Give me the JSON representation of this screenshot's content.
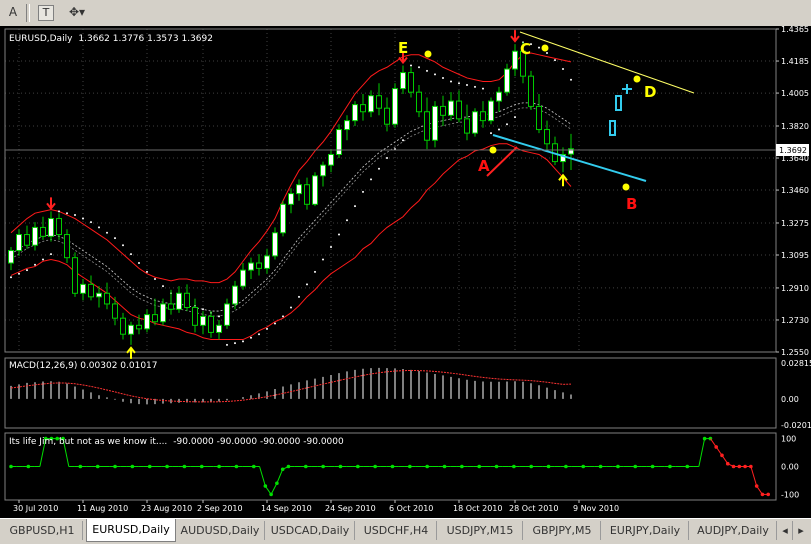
{
  "toolbar": {
    "text_tool": "A",
    "label_tool": "T",
    "arrows_tool": "✥▾"
  },
  "colors": {
    "background": "#000000",
    "grid": "#404040",
    "bull_candle": "#ffffff",
    "bear_candle": "#000000",
    "candle_outline": "#00cc00",
    "bands": "#ff1a1a",
    "sar_dots": "#ffffff",
    "macd_hist": "#ffffff",
    "macd_signal": "#ff3333",
    "life_green": "#00e000",
    "life_red": "#ff2020",
    "resistance_line": "#ffff66",
    "support_line": "#33ccee",
    "annotation_yellow": "#ffff00",
    "annotation_red": "#ff1010"
  },
  "chart_data": [
    {
      "type": "candlestick",
      "title": "EURUSD,Daily",
      "ohlc_text": "1.3662 1.3776 1.3573 1.3692",
      "current_price": "1.3692",
      "ylim": [
        1.255,
        1.4365
      ],
      "y_ticks": [
        "1.4365",
        "1.4185",
        "1.4005",
        "1.3820",
        "1.3640",
        "1.3460",
        "1.3275",
        "1.3095",
        "1.2910",
        "1.2730",
        "1.2550"
      ],
      "x_labels": [
        "30 Jul 2010",
        "11 Aug 2010",
        "23 Aug 2010",
        "2 Sep 2010",
        "14 Sep 2010",
        "24 Sep 2010",
        "6 Oct 2010",
        "18 Oct 2010",
        "28 Oct 2010",
        "9 Nov 2010"
      ],
      "x_label_bars": [
        1,
        9,
        17,
        24,
        32,
        40,
        48,
        56,
        63,
        71
      ],
      "bars": [
        [
          1.305,
          1.314,
          1.301,
          1.312
        ],
        [
          1.312,
          1.324,
          1.309,
          1.321
        ],
        [
          1.321,
          1.326,
          1.313,
          1.315
        ],
        [
          1.315,
          1.328,
          1.312,
          1.325
        ],
        [
          1.325,
          1.331,
          1.318,
          1.32
        ],
        [
          1.32,
          1.334,
          1.317,
          1.33
        ],
        [
          1.33,
          1.333,
          1.318,
          1.321
        ],
        [
          1.321,
          1.324,
          1.305,
          1.308
        ],
        [
          1.308,
          1.311,
          1.286,
          1.288
        ],
        [
          1.288,
          1.296,
          1.284,
          1.293
        ],
        [
          1.293,
          1.298,
          1.284,
          1.286
        ],
        [
          1.286,
          1.292,
          1.28,
          1.288
        ],
        [
          1.288,
          1.294,
          1.279,
          1.282
        ],
        [
          1.282,
          1.286,
          1.27,
          1.274
        ],
        [
          1.274,
          1.277,
          1.262,
          1.265
        ],
        [
          1.265,
          1.272,
          1.259,
          1.27
        ],
        [
          1.27,
          1.276,
          1.265,
          1.268
        ],
        [
          1.268,
          1.279,
          1.266,
          1.276
        ],
        [
          1.276,
          1.285,
          1.27,
          1.272
        ],
        [
          1.272,
          1.285,
          1.27,
          1.282
        ],
        [
          1.282,
          1.29,
          1.276,
          1.279
        ],
        [
          1.279,
          1.292,
          1.277,
          1.288
        ],
        [
          1.288,
          1.293,
          1.278,
          1.28
        ],
        [
          1.28,
          1.285,
          1.266,
          1.27
        ],
        [
          1.27,
          1.278,
          1.265,
          1.275
        ],
        [
          1.275,
          1.278,
          1.263,
          1.266
        ],
        [
          1.266,
          1.273,
          1.262,
          1.27
        ],
        [
          1.27,
          1.285,
          1.268,
          1.282
        ],
        [
          1.282,
          1.295,
          1.279,
          1.292
        ],
        [
          1.292,
          1.305,
          1.29,
          1.301
        ],
        [
          1.301,
          1.308,
          1.296,
          1.305
        ],
        [
          1.305,
          1.31,
          1.298,
          1.302
        ],
        [
          1.302,
          1.313,
          1.299,
          1.309
        ],
        [
          1.309,
          1.325,
          1.307,
          1.322
        ],
        [
          1.322,
          1.34,
          1.32,
          1.338
        ],
        [
          1.338,
          1.347,
          1.333,
          1.344
        ],
        [
          1.344,
          1.352,
          1.34,
          1.349
        ],
        [
          1.349,
          1.353,
          1.335,
          1.338
        ],
        [
          1.338,
          1.356,
          1.337,
          1.354
        ],
        [
          1.354,
          1.362,
          1.348,
          1.36
        ],
        [
          1.36,
          1.369,
          1.356,
          1.366
        ],
        [
          1.366,
          1.383,
          1.364,
          1.38
        ],
        [
          1.38,
          1.388,
          1.374,
          1.385
        ],
        [
          1.385,
          1.396,
          1.382,
          1.394
        ],
        [
          1.394,
          1.4,
          1.385,
          1.39
        ],
        [
          1.39,
          1.402,
          1.387,
          1.399
        ],
        [
          1.399,
          1.406,
          1.388,
          1.392
        ],
        [
          1.392,
          1.398,
          1.379,
          1.383
        ],
        [
          1.383,
          1.406,
          1.381,
          1.403
        ],
        [
          1.403,
          1.416,
          1.4,
          1.412
        ],
        [
          1.412,
          1.415,
          1.398,
          1.401
        ],
        [
          1.401,
          1.405,
          1.387,
          1.39
        ],
        [
          1.39,
          1.398,
          1.369,
          1.374
        ],
        [
          1.374,
          1.396,
          1.37,
          1.393
        ],
        [
          1.393,
          1.399,
          1.382,
          1.388
        ],
        [
          1.388,
          1.401,
          1.385,
          1.396
        ],
        [
          1.396,
          1.402,
          1.384,
          1.386
        ],
        [
          1.386,
          1.394,
          1.374,
          1.378
        ],
        [
          1.378,
          1.392,
          1.376,
          1.39
        ],
        [
          1.39,
          1.396,
          1.381,
          1.385
        ],
        [
          1.385,
          1.398,
          1.383,
          1.396
        ],
        [
          1.396,
          1.404,
          1.39,
          1.401
        ],
        [
          1.401,
          1.417,
          1.399,
          1.414
        ],
        [
          1.414,
          1.428,
          1.41,
          1.424
        ],
        [
          1.424,
          1.429,
          1.406,
          1.41
        ],
        [
          1.41,
          1.413,
          1.391,
          1.393
        ],
        [
          1.393,
          1.4,
          1.378,
          1.38
        ],
        [
          1.38,
          1.385,
          1.368,
          1.372
        ],
        [
          1.372,
          1.376,
          1.36,
          1.362
        ],
        [
          1.362,
          1.37,
          1.356,
          1.366
        ],
        [
          1.3662,
          1.3776,
          1.3573,
          1.3692
        ]
      ],
      "bands_upper": [
        1.322,
        1.326,
        1.33,
        1.333,
        1.334,
        1.335,
        1.334,
        1.332,
        1.33,
        1.327,
        1.324,
        1.321,
        1.318,
        1.314,
        1.31,
        1.306,
        1.302,
        1.299,
        1.297,
        1.296,
        1.295,
        1.296,
        1.296,
        1.295,
        1.295,
        1.294,
        1.294,
        1.296,
        1.3,
        1.306,
        1.312,
        1.317,
        1.323,
        1.33,
        1.34,
        1.349,
        1.357,
        1.362,
        1.368,
        1.373,
        1.379,
        1.386,
        1.393,
        1.4,
        1.405,
        1.41,
        1.413,
        1.415,
        1.418,
        1.421,
        1.422,
        1.422,
        1.42,
        1.418,
        1.415,
        1.413,
        1.411,
        1.409,
        1.408,
        1.407,
        1.407,
        1.408,
        1.412,
        1.418,
        1.422,
        1.423,
        1.422,
        1.421,
        1.42,
        1.419,
        1.418
      ],
      "bands_middle": [
        1.31,
        1.313,
        1.316,
        1.318,
        1.32,
        1.321,
        1.32,
        1.318,
        1.315,
        1.312,
        1.309,
        1.306,
        1.303,
        1.299,
        1.295,
        1.291,
        1.288,
        1.286,
        1.284,
        1.283,
        1.282,
        1.282,
        1.281,
        1.28,
        1.279,
        1.278,
        1.278,
        1.279,
        1.281,
        1.284,
        1.288,
        1.292,
        1.296,
        1.301,
        1.307,
        1.313,
        1.319,
        1.324,
        1.329,
        1.334,
        1.339,
        1.344,
        1.349,
        1.354,
        1.359,
        1.363,
        1.367,
        1.37,
        1.373,
        1.376,
        1.379,
        1.381,
        1.383,
        1.384,
        1.385,
        1.386,
        1.387,
        1.387,
        1.388,
        1.388,
        1.389,
        1.39,
        1.392,
        1.394,
        1.395,
        1.395,
        1.394,
        1.392,
        1.389,
        1.386,
        1.383
      ],
      "bands_lower": [
        1.298,
        1.3,
        1.302,
        1.303,
        1.306,
        1.307,
        1.306,
        1.304,
        1.3,
        1.297,
        1.294,
        1.291,
        1.288,
        1.284,
        1.28,
        1.276,
        1.274,
        1.273,
        1.271,
        1.27,
        1.269,
        1.268,
        1.266,
        1.265,
        1.263,
        1.262,
        1.262,
        1.262,
        1.262,
        1.262,
        1.264,
        1.267,
        1.269,
        1.272,
        1.274,
        1.277,
        1.281,
        1.286,
        1.29,
        1.295,
        1.299,
        1.302,
        1.305,
        1.308,
        1.313,
        1.316,
        1.321,
        1.325,
        1.328,
        1.331,
        1.336,
        1.34,
        1.346,
        1.35,
        1.355,
        1.359,
        1.363,
        1.365,
        1.368,
        1.369,
        1.371,
        1.372,
        1.372,
        1.37,
        1.368,
        1.367,
        1.366,
        1.363,
        1.358,
        1.353,
        1.348
      ],
      "sar": [
        1.297,
        1.299,
        1.301,
        1.304,
        1.307,
        1.31,
        1.334,
        1.333,
        1.332,
        1.33,
        1.328,
        1.325,
        1.322,
        1.319,
        1.315,
        1.31,
        1.305,
        1.3,
        1.296,
        1.292,
        1.288,
        1.285,
        1.283,
        1.281,
        1.279,
        1.277,
        1.275,
        1.259,
        1.26,
        1.261,
        1.263,
        1.265,
        1.268,
        1.271,
        1.275,
        1.28,
        1.286,
        1.293,
        1.3,
        1.307,
        1.314,
        1.321,
        1.329,
        1.337,
        1.345,
        1.352,
        1.358,
        1.364,
        1.369,
        1.374,
        1.416,
        1.415,
        1.413,
        1.411,
        1.409,
        1.407,
        1.406,
        1.405,
        1.404,
        1.403,
        1.378,
        1.38,
        1.383,
        1.387,
        1.429,
        1.428,
        1.426,
        1.423,
        1.419,
        1.414,
        1.408
      ],
      "arrows": [
        {
          "bar": 5,
          "direction": "down"
        },
        {
          "bar": 15,
          "direction": "up"
        },
        {
          "bar": 49,
          "direction": "down"
        },
        {
          "bar": 63,
          "direction": "down"
        },
        {
          "bar": 69,
          "direction": "up"
        }
      ],
      "annotations": [
        {
          "text": "E",
          "bar": 46,
          "price": 1.4215
        },
        {
          "text": "C",
          "bar": 60,
          "price": 1.423
        },
        {
          "text": "D",
          "bar": 75,
          "price": 1.403
        },
        {
          "text": "A",
          "bar": 55,
          "price": 1.357
        },
        {
          "text": "B",
          "bar": 72,
          "price": 1.333
        }
      ]
    },
    {
      "type": "bar",
      "title": "MACD(12,26,9) 0.00302 0.01017",
      "y_ticks": [
        "0.02815",
        "0.00",
        "-0.02010"
      ],
      "ylim": [
        -0.0201,
        0.0282
      ],
      "histogram": [
        0.009,
        0.01,
        0.011,
        0.0115,
        0.012,
        0.0122,
        0.0118,
        0.0105,
        0.0085,
        0.0065,
        0.0045,
        0.0025,
        0.001,
        -0.0005,
        -0.002,
        -0.003,
        -0.0036,
        -0.0038,
        -0.0036,
        -0.0033,
        -0.003,
        -0.0027,
        -0.0025,
        -0.0024,
        -0.0023,
        -0.0022,
        -0.0018,
        -0.001,
        0.0,
        0.0012,
        0.0025,
        0.0038,
        0.0052,
        0.0068,
        0.0085,
        0.01,
        0.0115,
        0.0128,
        0.014,
        0.0152,
        0.0165,
        0.0178,
        0.019,
        0.02,
        0.0208,
        0.0212,
        0.0214,
        0.0212,
        0.021,
        0.0206,
        0.02,
        0.0192,
        0.0182,
        0.0172,
        0.0162,
        0.0152,
        0.0142,
        0.0132,
        0.0124,
        0.012,
        0.0118,
        0.0118,
        0.012,
        0.0122,
        0.0118,
        0.0108,
        0.0094,
        0.0078,
        0.006,
        0.0045,
        0.003
      ],
      "signal": [
        0.0075,
        0.0082,
        0.009,
        0.0097,
        0.0103,
        0.0108,
        0.011,
        0.0109,
        0.0104,
        0.0096,
        0.0086,
        0.0074,
        0.0061,
        0.0048,
        0.0034,
        0.0021,
        0.001,
        0.0001,
        -0.0006,
        -0.0011,
        -0.0015,
        -0.0017,
        -0.0019,
        -0.002,
        -0.0021,
        -0.0021,
        -0.002,
        -0.0018,
        -0.0014,
        -0.0009,
        -0.0002,
        0.0006,
        0.0015,
        0.0026,
        0.0038,
        0.005,
        0.0063,
        0.0076,
        0.0089,
        0.0102,
        0.0114,
        0.0127,
        0.0139,
        0.0151,
        0.0162,
        0.0172,
        0.018,
        0.0187,
        0.0192,
        0.0195,
        0.0196,
        0.0195,
        0.0193,
        0.0189,
        0.0184,
        0.0178,
        0.0171,
        0.0163,
        0.0155,
        0.0148,
        0.0142,
        0.0137,
        0.0134,
        0.0131,
        0.0129,
        0.0126,
        0.0121,
        0.0115,
        0.0107,
        0.01,
        0.0102
      ]
    },
    {
      "type": "line",
      "title": "Its life Jim, but not as we know it....",
      "values_text": "-90.0000 -90.0000 -90.0000 -90.0000",
      "y_ticks": [
        "100",
        "0.00",
        "-100"
      ],
      "ylim": [
        -120,
        120
      ],
      "values": [
        0,
        0,
        0,
        0,
        0,
        0,
        100,
        100,
        100,
        100,
        0,
        0,
        0,
        0,
        0,
        0,
        0,
        0,
        0,
        0,
        0,
        0,
        0,
        0,
        0,
        0,
        0,
        0,
        0,
        0,
        0,
        0,
        0,
        0,
        0,
        0,
        0,
        0,
        0,
        0,
        0,
        0,
        0,
        0,
        -70,
        -100,
        -60,
        -10,
        0,
        0,
        0,
        0,
        0,
        0,
        0,
        0,
        0,
        0,
        0,
        0,
        0,
        0,
        0,
        0,
        0,
        0,
        0,
        0,
        0,
        0,
        0,
        0,
        0,
        0,
        0,
        0,
        0,
        0,
        0,
        0,
        0,
        0,
        0,
        0,
        0,
        0,
        0,
        0,
        0,
        0,
        0,
        0,
        0,
        0,
        0,
        0,
        0,
        0,
        0,
        0,
        0,
        0,
        0,
        0,
        0,
        0,
        0,
        0,
        0,
        0,
        0,
        0,
        0,
        0,
        0,
        0,
        0,
        0,
        0,
        0,
        100,
        100,
        70,
        40,
        10,
        0,
        0,
        0,
        0,
        -70,
        -100,
        -100
      ],
      "red_from": 122
    }
  ],
  "symbol_tabs": [
    {
      "label": "GBPUSD,H1",
      "active": false
    },
    {
      "label": "EURUSD,Daily",
      "active": true
    },
    {
      "label": "AUDUSD,Daily",
      "active": false
    },
    {
      "label": "USDCAD,Daily",
      "active": false
    },
    {
      "label": "USDCHF,H4",
      "active": false
    },
    {
      "label": "USDJPY,M15",
      "active": false
    },
    {
      "label": "GBPJPY,M5",
      "active": false
    },
    {
      "label": "EURJPY,Daily",
      "active": false
    },
    {
      "label": "AUDJPY,Daily",
      "active": false
    }
  ]
}
